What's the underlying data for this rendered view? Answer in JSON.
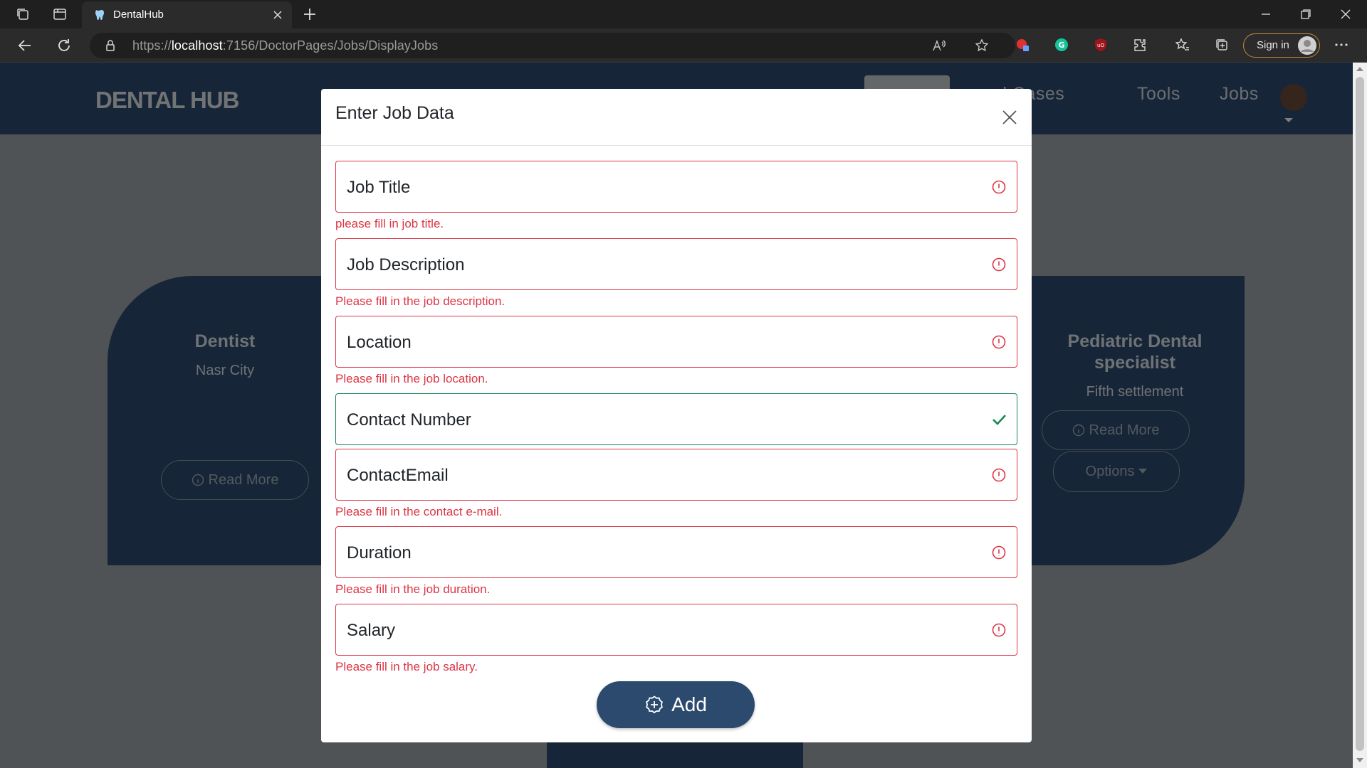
{
  "browser": {
    "tab_title": "DentalHub",
    "url_prefix": "https://",
    "url_host": "localhost",
    "url_rest": ":7156/DoctorPages/Jobs/DisplayJobs",
    "signin_label": "Sign in"
  },
  "site": {
    "logo": "DENTAL HUB",
    "nav": {
      "cases_partial": "al Cases",
      "tools": "Tools",
      "jobs": "Jobs"
    }
  },
  "cards": {
    "left": {
      "title": "Dentist",
      "location": "Nasr City",
      "read_more": "Read More"
    },
    "right": {
      "title_line1": "Pediatric Dental",
      "title_line2": "specialist",
      "location": "Fifth settlement",
      "read_more": "Read More",
      "options": "Options"
    }
  },
  "modal": {
    "title": "Enter Job Data",
    "fields": [
      {
        "label": "Job Title",
        "state": "invalid",
        "error": "please fill in job title."
      },
      {
        "label": "Job Description",
        "state": "invalid",
        "error": "Please fill in the job description."
      },
      {
        "label": "Location",
        "state": "invalid",
        "error": "Please fill in the job location."
      },
      {
        "label": "Contact Number",
        "state": "valid",
        "error": ""
      },
      {
        "label": "ContactEmail",
        "state": "invalid",
        "error": "Please fill in the contact e-mail."
      },
      {
        "label": "Duration",
        "state": "invalid",
        "error": "Please fill in the job duration."
      },
      {
        "label": "Salary",
        "state": "invalid",
        "error": "Please fill in the job salary."
      }
    ],
    "add_label": "Add"
  },
  "colors": {
    "brand": "#2c4a6e",
    "invalid": "#dc3545",
    "valid": "#198754"
  }
}
